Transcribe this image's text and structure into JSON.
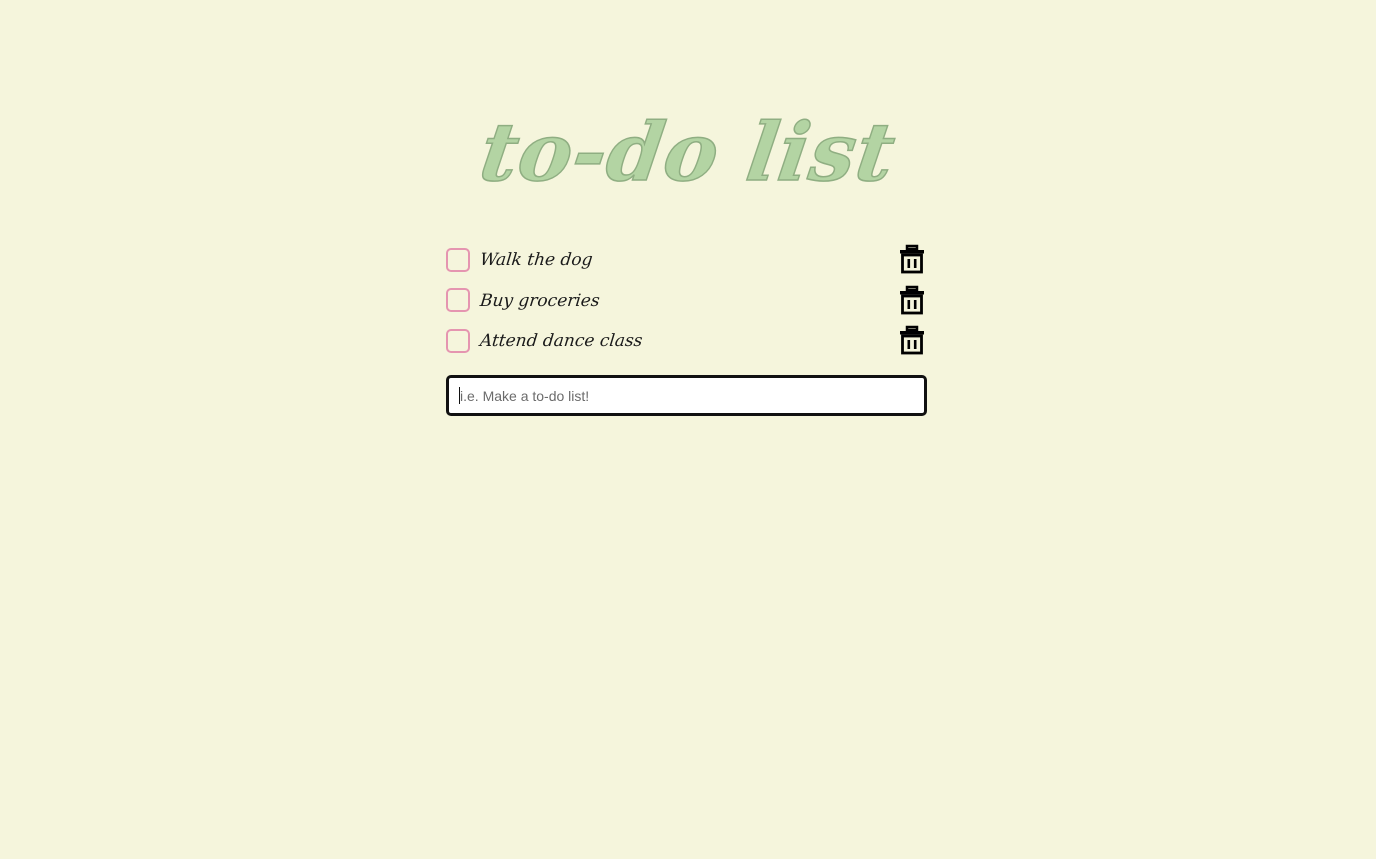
{
  "app": {
    "title": "to-do list"
  },
  "todos": [
    {
      "label": "Walk the dog",
      "checked": false
    },
    {
      "label": "Buy groceries",
      "checked": false
    },
    {
      "label": "Attend dance class",
      "checked": false
    }
  ],
  "input": {
    "placeholder": "i.e. Make a to-do list!",
    "value": ""
  },
  "icons": {
    "checkbox": "checkbox-icon",
    "delete": "trash-icon"
  },
  "colors": {
    "background": "#f5f5dc",
    "title": "#b3d4a3",
    "checkbox_border": "#e595b0",
    "text": "#1a1a1a"
  }
}
